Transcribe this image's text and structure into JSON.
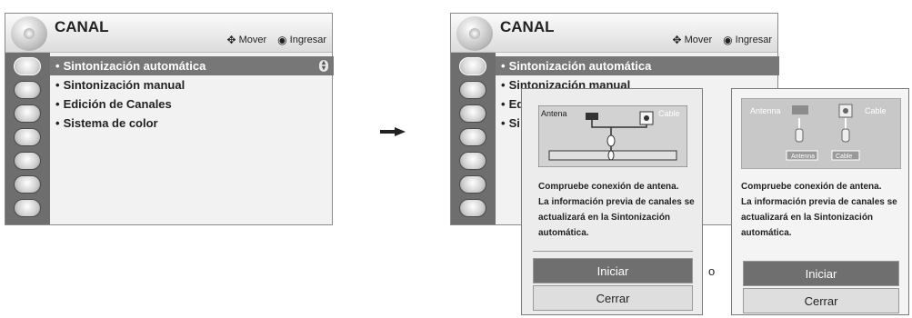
{
  "menu": {
    "title": "CANAL",
    "hint_move": "Mover",
    "hint_enter": "Ingresar",
    "items": [
      "Sintonización automática",
      "Sintonización manual",
      "Edición de Canales",
      "Sistema de color"
    ],
    "visible_items_right": [
      "Sintonización automática",
      "Sintonización manual",
      "Ed",
      "Si"
    ],
    "side_icons": [
      "channel-icon",
      "picture-icon",
      "audio-icon",
      "time-icon",
      "lock-icon",
      "option-icon",
      "input-icon"
    ]
  },
  "popup_a": {
    "label_antenna": "Antena",
    "label_cable": "Cable",
    "message": [
      "Compruebe conexión de antena.",
      "La información previa de canales se",
      "actualizará en la Sintonización",
      "automática."
    ],
    "start": "Iniciar",
    "close": "Cerrar"
  },
  "popup_b": {
    "label_antenna": "Antenna",
    "label_cable": "Cable",
    "box_antenna": "Antenna",
    "box_cable": "Cable",
    "message": [
      "Compruebe conexión de antena.",
      "La información previa de canales se",
      "actualizará en la Sintonización",
      "automática."
    ],
    "start": "Iniciar",
    "close": "Cerrar"
  },
  "or_label": "o",
  "colors": {
    "selected_row": "#777777",
    "sidebar": "#6e6e6e",
    "primary_button": "#6f6f6f"
  }
}
